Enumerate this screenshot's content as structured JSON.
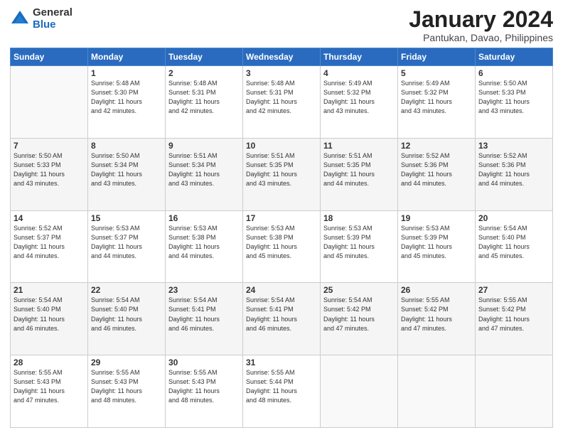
{
  "logo": {
    "general": "General",
    "blue": "Blue"
  },
  "title": "January 2024",
  "subtitle": "Pantukan, Davao, Philippines",
  "days_header": [
    "Sunday",
    "Monday",
    "Tuesday",
    "Wednesday",
    "Thursday",
    "Friday",
    "Saturday"
  ],
  "weeks": [
    [
      {
        "num": "",
        "info": ""
      },
      {
        "num": "1",
        "info": "Sunrise: 5:48 AM\nSunset: 5:30 PM\nDaylight: 11 hours\nand 42 minutes."
      },
      {
        "num": "2",
        "info": "Sunrise: 5:48 AM\nSunset: 5:31 PM\nDaylight: 11 hours\nand 42 minutes."
      },
      {
        "num": "3",
        "info": "Sunrise: 5:48 AM\nSunset: 5:31 PM\nDaylight: 11 hours\nand 42 minutes."
      },
      {
        "num": "4",
        "info": "Sunrise: 5:49 AM\nSunset: 5:32 PM\nDaylight: 11 hours\nand 43 minutes."
      },
      {
        "num": "5",
        "info": "Sunrise: 5:49 AM\nSunset: 5:32 PM\nDaylight: 11 hours\nand 43 minutes."
      },
      {
        "num": "6",
        "info": "Sunrise: 5:50 AM\nSunset: 5:33 PM\nDaylight: 11 hours\nand 43 minutes."
      }
    ],
    [
      {
        "num": "7",
        "info": "Sunrise: 5:50 AM\nSunset: 5:33 PM\nDaylight: 11 hours\nand 43 minutes."
      },
      {
        "num": "8",
        "info": "Sunrise: 5:50 AM\nSunset: 5:34 PM\nDaylight: 11 hours\nand 43 minutes."
      },
      {
        "num": "9",
        "info": "Sunrise: 5:51 AM\nSunset: 5:34 PM\nDaylight: 11 hours\nand 43 minutes."
      },
      {
        "num": "10",
        "info": "Sunrise: 5:51 AM\nSunset: 5:35 PM\nDaylight: 11 hours\nand 43 minutes."
      },
      {
        "num": "11",
        "info": "Sunrise: 5:51 AM\nSunset: 5:35 PM\nDaylight: 11 hours\nand 44 minutes."
      },
      {
        "num": "12",
        "info": "Sunrise: 5:52 AM\nSunset: 5:36 PM\nDaylight: 11 hours\nand 44 minutes."
      },
      {
        "num": "13",
        "info": "Sunrise: 5:52 AM\nSunset: 5:36 PM\nDaylight: 11 hours\nand 44 minutes."
      }
    ],
    [
      {
        "num": "14",
        "info": "Sunrise: 5:52 AM\nSunset: 5:37 PM\nDaylight: 11 hours\nand 44 minutes."
      },
      {
        "num": "15",
        "info": "Sunrise: 5:53 AM\nSunset: 5:37 PM\nDaylight: 11 hours\nand 44 minutes."
      },
      {
        "num": "16",
        "info": "Sunrise: 5:53 AM\nSunset: 5:38 PM\nDaylight: 11 hours\nand 44 minutes."
      },
      {
        "num": "17",
        "info": "Sunrise: 5:53 AM\nSunset: 5:38 PM\nDaylight: 11 hours\nand 45 minutes."
      },
      {
        "num": "18",
        "info": "Sunrise: 5:53 AM\nSunset: 5:39 PM\nDaylight: 11 hours\nand 45 minutes."
      },
      {
        "num": "19",
        "info": "Sunrise: 5:53 AM\nSunset: 5:39 PM\nDaylight: 11 hours\nand 45 minutes."
      },
      {
        "num": "20",
        "info": "Sunrise: 5:54 AM\nSunset: 5:40 PM\nDaylight: 11 hours\nand 45 minutes."
      }
    ],
    [
      {
        "num": "21",
        "info": "Sunrise: 5:54 AM\nSunset: 5:40 PM\nDaylight: 11 hours\nand 46 minutes."
      },
      {
        "num": "22",
        "info": "Sunrise: 5:54 AM\nSunset: 5:40 PM\nDaylight: 11 hours\nand 46 minutes."
      },
      {
        "num": "23",
        "info": "Sunrise: 5:54 AM\nSunset: 5:41 PM\nDaylight: 11 hours\nand 46 minutes."
      },
      {
        "num": "24",
        "info": "Sunrise: 5:54 AM\nSunset: 5:41 PM\nDaylight: 11 hours\nand 46 minutes."
      },
      {
        "num": "25",
        "info": "Sunrise: 5:54 AM\nSunset: 5:42 PM\nDaylight: 11 hours\nand 47 minutes."
      },
      {
        "num": "26",
        "info": "Sunrise: 5:55 AM\nSunset: 5:42 PM\nDaylight: 11 hours\nand 47 minutes."
      },
      {
        "num": "27",
        "info": "Sunrise: 5:55 AM\nSunset: 5:42 PM\nDaylight: 11 hours\nand 47 minutes."
      }
    ],
    [
      {
        "num": "28",
        "info": "Sunrise: 5:55 AM\nSunset: 5:43 PM\nDaylight: 11 hours\nand 47 minutes."
      },
      {
        "num": "29",
        "info": "Sunrise: 5:55 AM\nSunset: 5:43 PM\nDaylight: 11 hours\nand 48 minutes."
      },
      {
        "num": "30",
        "info": "Sunrise: 5:55 AM\nSunset: 5:43 PM\nDaylight: 11 hours\nand 48 minutes."
      },
      {
        "num": "31",
        "info": "Sunrise: 5:55 AM\nSunset: 5:44 PM\nDaylight: 11 hours\nand 48 minutes."
      },
      {
        "num": "",
        "info": ""
      },
      {
        "num": "",
        "info": ""
      },
      {
        "num": "",
        "info": ""
      }
    ]
  ]
}
